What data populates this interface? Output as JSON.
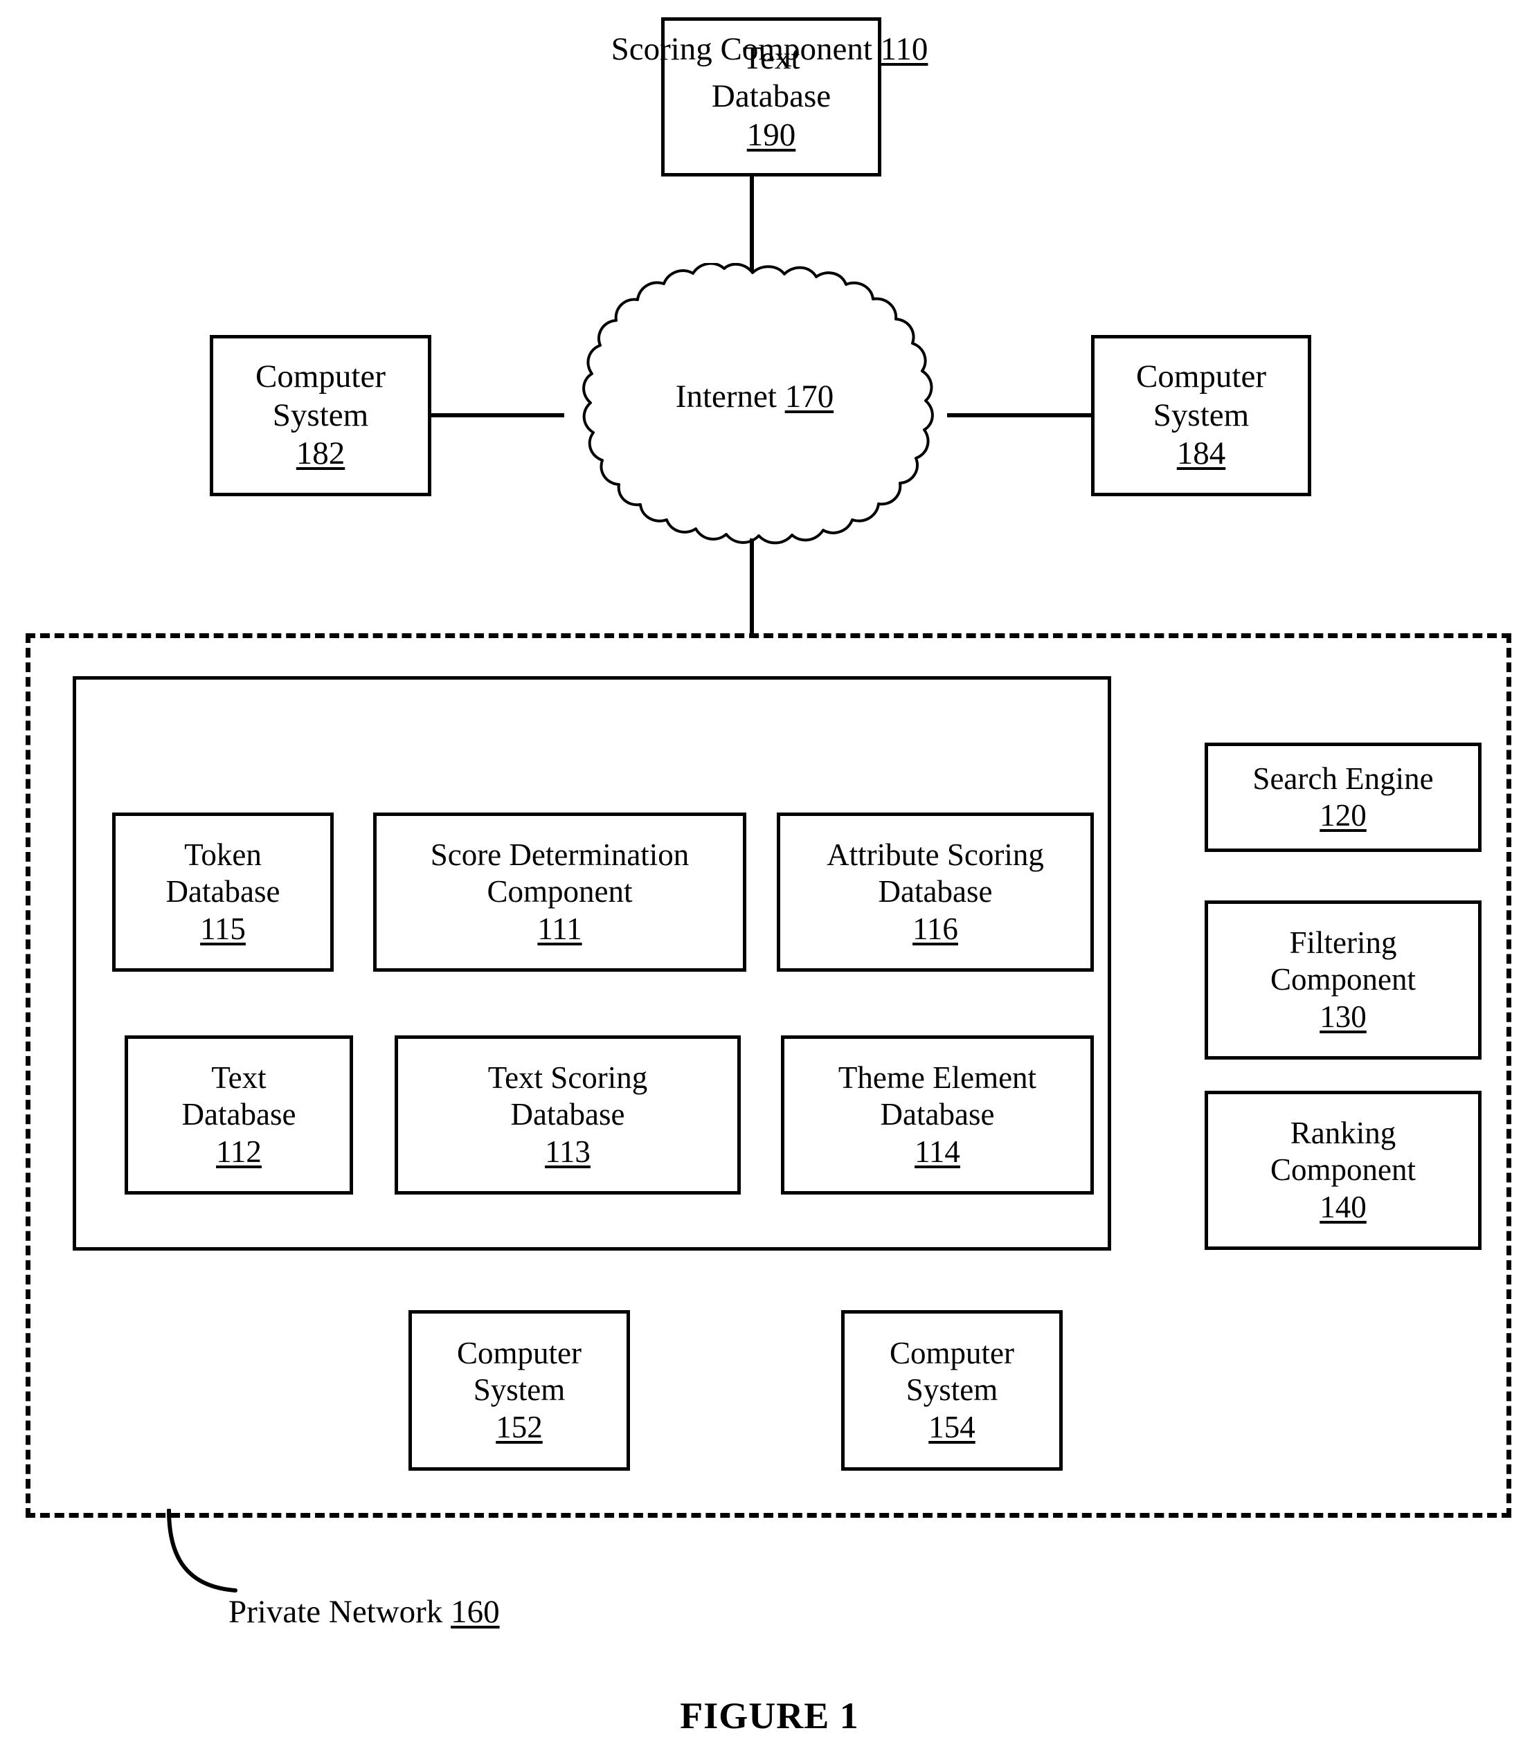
{
  "figure": {
    "caption": "FIGURE 1"
  },
  "external": {
    "text_database": {
      "line1": "Text",
      "line2": "Database",
      "ref": "190"
    },
    "computer_system_left": {
      "line1": "Computer",
      "line2": "System",
      "ref": "182"
    },
    "computer_system_right": {
      "line1": "Computer",
      "line2": "System",
      "ref": "184"
    },
    "internet": {
      "label": "Internet",
      "ref": "170"
    }
  },
  "private_network": {
    "label": "Private Network",
    "ref": "160"
  },
  "scoring_component": {
    "title": "Scoring Component",
    "ref": "110",
    "modules": [
      {
        "line1": "Token",
        "line2": "Database",
        "ref": "115"
      },
      {
        "line1": "Score Determination",
        "line2": "Component",
        "ref": "111"
      },
      {
        "line1": "Attribute Scoring",
        "line2": "Database",
        "ref": "116"
      },
      {
        "line1": "Text",
        "line2": "Database",
        "ref": "112"
      },
      {
        "line1": "Text Scoring",
        "line2": "Database",
        "ref": "113"
      },
      {
        "line1": "Theme Element",
        "line2": "Database",
        "ref": "114"
      }
    ]
  },
  "services": [
    {
      "line1": "Search Engine",
      "line2": "",
      "ref": "120"
    },
    {
      "line1": "Filtering",
      "line2": "Component",
      "ref": "130"
    },
    {
      "line1": "Ranking",
      "line2": "Component",
      "ref": "140"
    }
  ],
  "internal_systems": [
    {
      "line1": "Computer",
      "line2": "System",
      "ref": "152"
    },
    {
      "line1": "Computer",
      "line2": "System",
      "ref": "154"
    }
  ],
  "colors": {
    "stroke": "#000000",
    "background": "#ffffff"
  }
}
